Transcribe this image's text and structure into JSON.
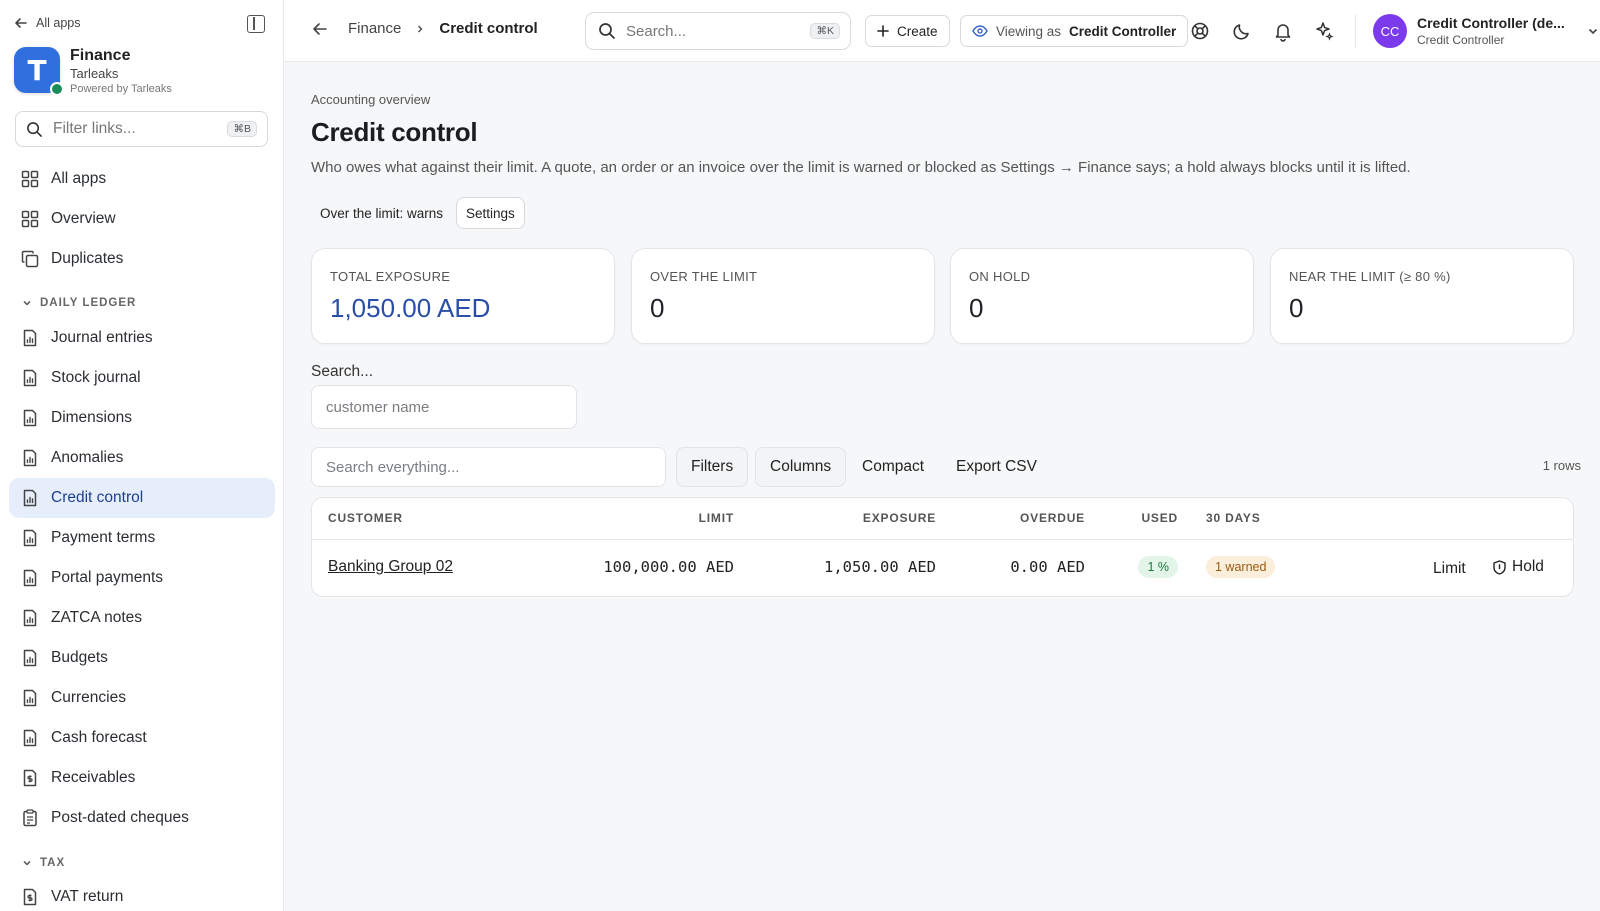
{
  "sidebar": {
    "back_label": "All apps",
    "brand": {
      "name": "Finance",
      "org": "Tarleaks",
      "powered": "Powered by Tarleaks",
      "logo_letter": "T"
    },
    "filter": {
      "placeholder": "Filter links...",
      "shortcut": "⌘B"
    },
    "top_items": [
      {
        "label": "All apps",
        "icon": "grid-icon"
      },
      {
        "label": "Overview",
        "icon": "grid-icon"
      },
      {
        "label": "Duplicates",
        "icon": "copy-icon"
      }
    ],
    "section_daily": "DAILY LEDGER",
    "daily_items": [
      {
        "label": "Journal entries"
      },
      {
        "label": "Stock journal"
      },
      {
        "label": "Dimensions"
      },
      {
        "label": "Anomalies"
      },
      {
        "label": "Credit control",
        "active": true
      },
      {
        "label": "Payment terms"
      },
      {
        "label": "Portal payments"
      },
      {
        "label": "ZATCA notes"
      },
      {
        "label": "Budgets"
      },
      {
        "label": "Currencies"
      },
      {
        "label": "Cash forecast"
      },
      {
        "label": "Receivables",
        "icon": "dollar-doc-icon"
      },
      {
        "label": "Post-dated cheques",
        "icon": "clipboard-icon"
      }
    ],
    "section_tax": "TAX",
    "tax_items": [
      {
        "label": "VAT return",
        "icon": "dollar-doc-icon"
      }
    ]
  },
  "topbar": {
    "crumb_parent": "Finance",
    "crumb_current": "Credit control",
    "search_placeholder": "Search...",
    "search_shortcut": "⌘K",
    "create_label": "Create",
    "viewing_prefix": "Viewing as",
    "viewing_role": "Credit Controller",
    "user_initials": "CC",
    "user_name": "Credit Controller (de...",
    "user_role": "Credit Controller"
  },
  "page": {
    "eyebrow": "Accounting overview",
    "title": "Credit control",
    "description": "Who owes what against their limit. A quote, an order or an invoice over the limit is warned or blocked as Settings → Finance says; a hold always blocks until it is lifted.",
    "mode_label": "Over the limit: warns",
    "settings_label": "Settings"
  },
  "stats": [
    {
      "label": "TOTAL EXPOSURE",
      "value": "1,050.00 AED",
      "accent": "#2a4fa8"
    },
    {
      "label": "OVER THE LIMIT",
      "value": "0"
    },
    {
      "label": "ON HOLD",
      "value": "0"
    },
    {
      "label": "NEAR THE LIMIT (≥ 80 %)",
      "value": "0"
    }
  ],
  "customer_filter": {
    "label": "Search...",
    "placeholder": "customer name"
  },
  "toolbar": {
    "search_placeholder": "Search everything...",
    "filters_label": "Filters",
    "columns_label": "Columns",
    "compact_label": "Compact",
    "export_label": "Export CSV",
    "row_count": "1 rows"
  },
  "table": {
    "columns": [
      "CUSTOMER",
      "LIMIT",
      "EXPOSURE",
      "OVERDUE",
      "USED",
      "30 DAYS"
    ],
    "rows": [
      {
        "customer": "Banking Group 02",
        "limit": "100,000.00 AED",
        "exposure": "1,050.00 AED",
        "overdue": "0.00 AED",
        "used": "1 %",
        "days30": "1 warned",
        "action_limit": "Limit",
        "action_hold": "Hold"
      }
    ]
  }
}
